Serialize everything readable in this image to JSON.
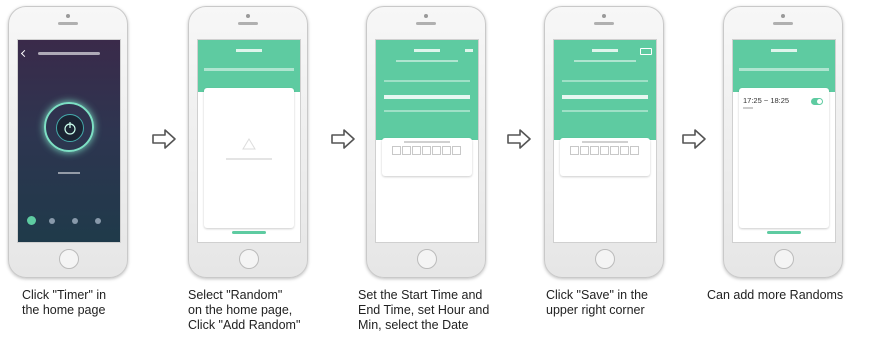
{
  "steps": [
    {
      "caption": [
        "Click \"Timer\" in",
        "the home page"
      ]
    },
    {
      "caption": [
        "Select \"Random\"",
        "on the home page,",
        "Click \"Add Random\""
      ]
    },
    {
      "caption": [
        "Set the Start Time and",
        "End Time, set Hour and",
        "Min, select the Date"
      ]
    },
    {
      "caption": [
        "Click \"Save\" in the",
        "upper right corner"
      ]
    },
    {
      "caption": [
        "Can add more Randoms"
      ]
    }
  ],
  "screen5": {
    "time_range": "17:25 ~ 18:25"
  },
  "colors": {
    "accent": "#5ecba1",
    "dark_screen": "#2e3550",
    "arrow": "#555555"
  },
  "icons": {
    "arrow": "right-arrow-icon",
    "power": "power-icon"
  }
}
